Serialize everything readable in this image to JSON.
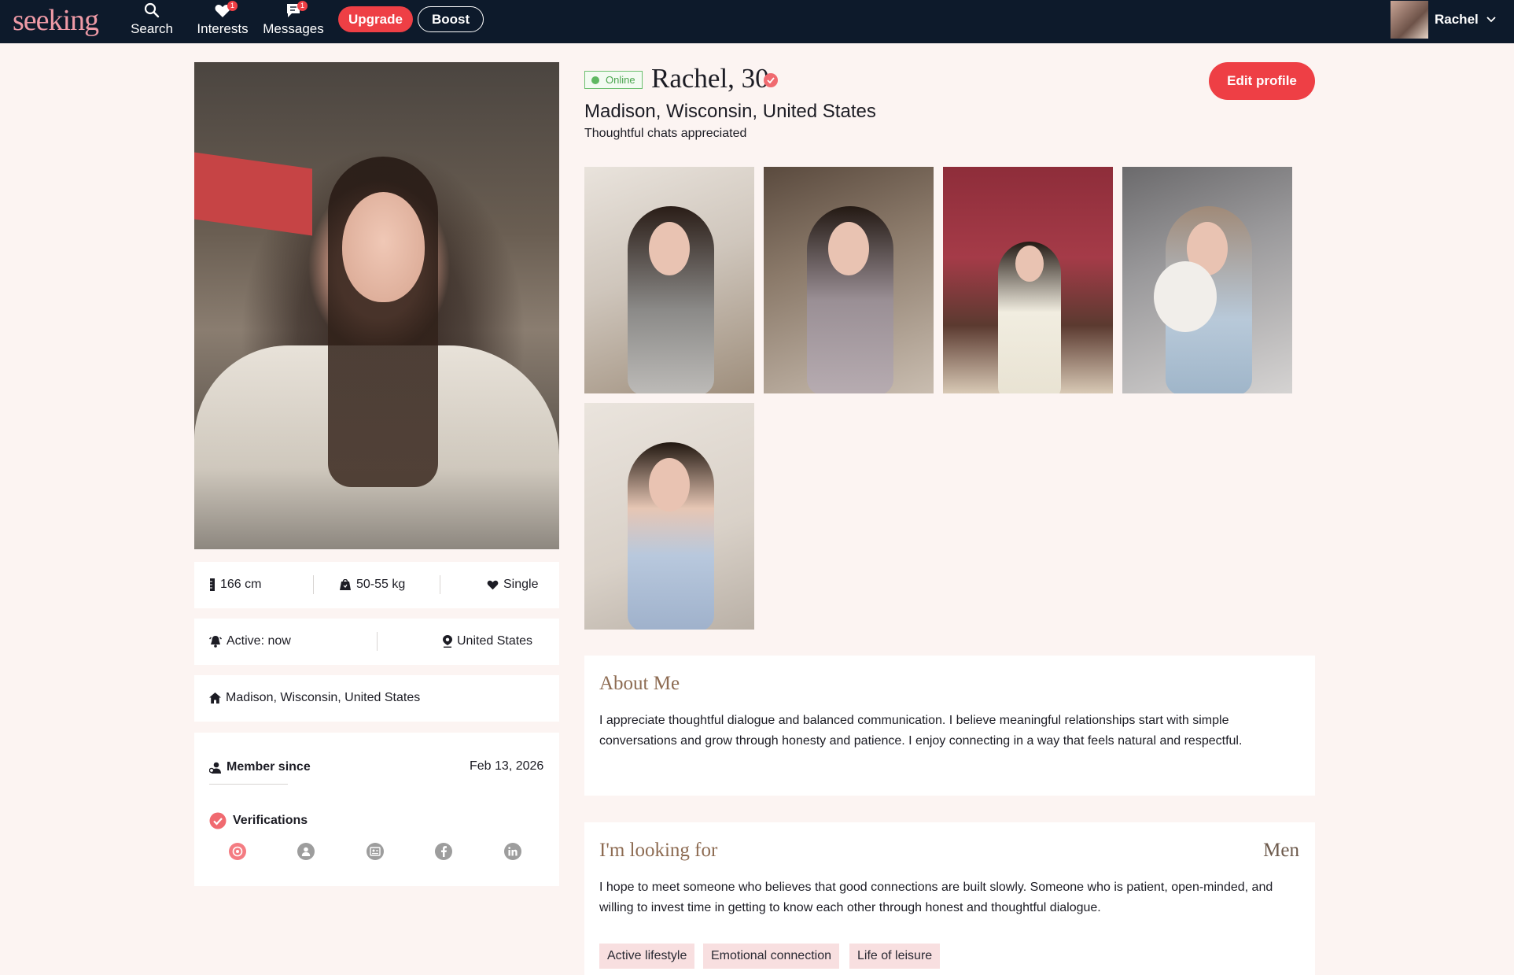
{
  "nav": {
    "logo": "seeking",
    "items": [
      {
        "label": "Search",
        "badge": ""
      },
      {
        "label": "Interests",
        "badge": "1"
      },
      {
        "label": "Messages",
        "badge": "1"
      }
    ],
    "upgrade_label": "Upgrade",
    "boost_label": "Boost",
    "user_name": "Rachel"
  },
  "profile": {
    "online_label": "Online",
    "name_age": "Rachel, 30",
    "location": "Madison, Wisconsin, United States",
    "tagline": "Thoughtful chats appreciated",
    "edit_label": "Edit profile"
  },
  "stats": {
    "height": "166 cm",
    "weight": "50-55 kg",
    "relationship": "Single",
    "active": "Active: now",
    "country": "United States",
    "home": "Madison, Wisconsin, United States"
  },
  "membership": {
    "member_since_label": "Member since",
    "member_since_value": "Feb 13, 2026",
    "verifications_label": "Verifications",
    "verification_icons": [
      "photo-verified-icon",
      "profile-icon",
      "id-card-icon",
      "facebook-icon",
      "linkedin-icon"
    ]
  },
  "about": {
    "title": "About Me",
    "text": "I appreciate thoughtful dialogue and balanced communication. I believe meaningful relationships start with simple conversations and grow through honesty and patience. I enjoy connecting in a way that feels natural and respectful."
  },
  "looking_for": {
    "title": "I'm looking for",
    "target": "Men",
    "text": "I hope to meet someone who believes that good connections are built slowly. Someone who is patient, open-minded, and willing to invest time in getting to know each other through honest and thoughtful dialogue.",
    "tags": [
      "Active lifestyle",
      "Emotional connection",
      "Life of leisure"
    ]
  },
  "colors": {
    "nav_bg": "#0d1a2b",
    "accent": "#ee3f45",
    "page_bg": "#fcf4f2",
    "online": "#5fb862",
    "tag_bg": "#f8dfe0",
    "section_title": "#8d6b52"
  }
}
